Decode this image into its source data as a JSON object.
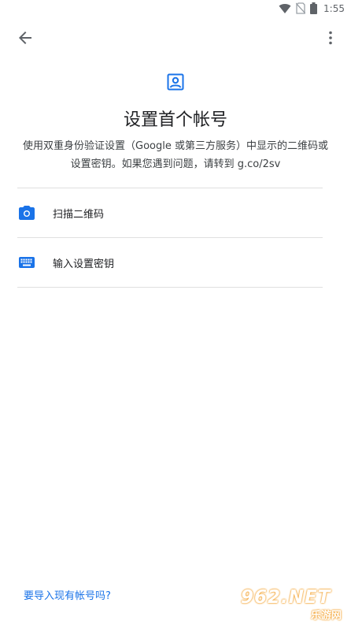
{
  "status_bar": {
    "time": "1:55",
    "icons": [
      "wifi-icon",
      "no-sim-icon",
      "battery-icon"
    ]
  },
  "app_bar": {
    "back_icon": "arrow-back-icon",
    "overflow_icon": "more-vert-icon"
  },
  "header": {
    "icon": "account-box-icon",
    "title": "设置首个帐号",
    "description": "使用双重身份验证设置（Google 或第三方服务）中显示的二维码或设置密钥。如果您遇到问题，请转到 g.co/2sv"
  },
  "options": [
    {
      "icon": "camera-icon",
      "label": "扫描二维码"
    },
    {
      "icon": "keyboard-icon",
      "label": "输入设置密钥"
    }
  ],
  "footer": {
    "link": "要导入现有帐号吗?"
  },
  "watermark": {
    "text": "962.NET",
    "subtext": "乐游网"
  },
  "colors": {
    "accent": "#1a73e8",
    "icon_gray": "#5f6368",
    "divider": "#e0e0e0",
    "title": "#202124"
  }
}
